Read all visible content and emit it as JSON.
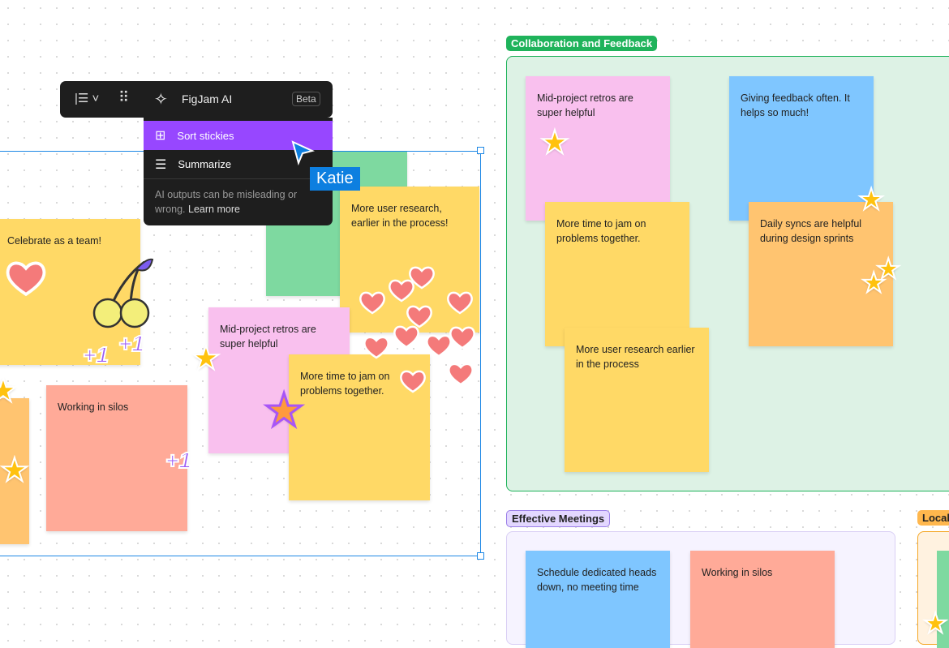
{
  "toolbar": {
    "ai_label": "FigJam AI",
    "beta_badge": "Beta"
  },
  "ai_menu": {
    "items": [
      {
        "label": "Sort stickies",
        "icon": "sort-grid-icon",
        "highlighted": true
      },
      {
        "label": "Summarize",
        "icon": "list-icon"
      }
    ],
    "disclaimer": "AI outputs can be misleading or wrong.",
    "learn_more": "Learn more"
  },
  "cursor": {
    "user": "Katie",
    "color": "#0d7fe0"
  },
  "left_stickies": [
    "Celebrate as a team!",
    "More user research, earlier in the process!",
    "Mid-project retros are super helpful",
    "More time to jam on problems together.",
    "Working in silos"
  ],
  "reactions": {
    "plus_one": "+1"
  },
  "sections": [
    {
      "title": "Collaboration and Feedback",
      "color": "#1fb35b",
      "stickies": [
        "Mid-project retros are super helpful",
        "Giving feedback often. It helps so much!",
        "More time to jam on problems together.",
        "Daily syncs are helpful during design sprints",
        "More user research earlier in the process"
      ]
    },
    {
      "title": "Effective Meetings",
      "color": "#9b7fe8",
      "stickies": [
        "Schedule dedicated heads down, no meeting time",
        "Working in silos"
      ]
    },
    {
      "title": "Local",
      "color": "#f5a623",
      "stickies": []
    }
  ],
  "colors": {
    "accent": "#9747ff",
    "selection": "#1e88e5"
  }
}
